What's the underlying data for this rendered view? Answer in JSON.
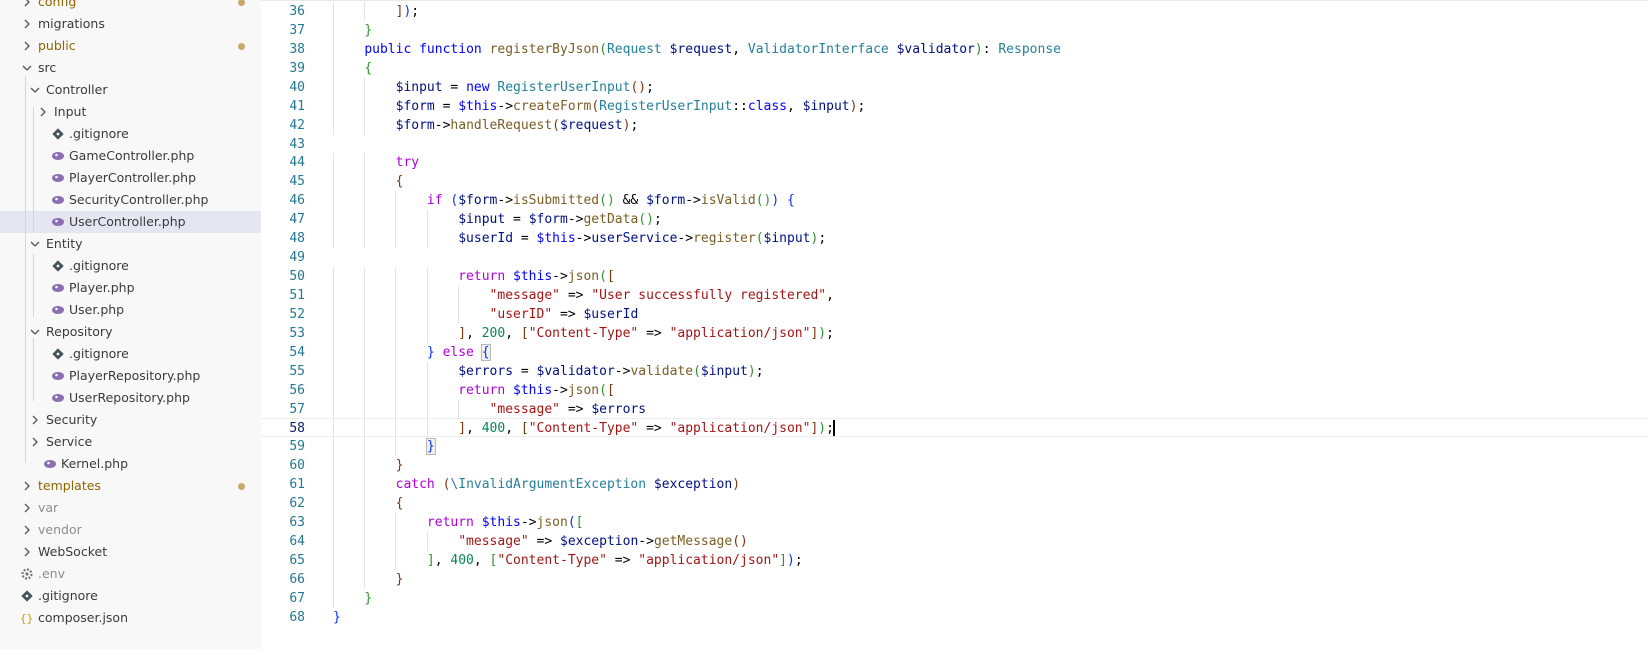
{
  "explorer": {
    "items": [
      {
        "label": "config",
        "kind": "folder",
        "state": "collapsed",
        "depth": 0,
        "status": "modified"
      },
      {
        "label": "migrations",
        "kind": "folder",
        "state": "collapsed",
        "depth": 0,
        "status": "normal"
      },
      {
        "label": "public",
        "kind": "folder",
        "state": "collapsed",
        "depth": 0,
        "status": "modified"
      },
      {
        "label": "src",
        "kind": "folder",
        "state": "expanded",
        "depth": 0,
        "status": "normal"
      },
      {
        "label": "Controller",
        "kind": "folder",
        "state": "expanded",
        "depth": 1,
        "status": "normal"
      },
      {
        "label": "Input",
        "kind": "folder",
        "state": "collapsed",
        "depth": 2,
        "status": "normal"
      },
      {
        "label": ".gitignore",
        "kind": "git",
        "depth": 2,
        "status": "normal"
      },
      {
        "label": "GameController.php",
        "kind": "php",
        "depth": 2,
        "status": "normal"
      },
      {
        "label": "PlayerController.php",
        "kind": "php",
        "depth": 2,
        "status": "normal"
      },
      {
        "label": "SecurityController.php",
        "kind": "php",
        "depth": 2,
        "status": "normal"
      },
      {
        "label": "UserController.php",
        "kind": "php",
        "depth": 2,
        "status": "normal",
        "selected": true
      },
      {
        "label": "Entity",
        "kind": "folder",
        "state": "expanded",
        "depth": 1,
        "status": "normal"
      },
      {
        "label": ".gitignore",
        "kind": "git",
        "depth": 2,
        "status": "normal"
      },
      {
        "label": "Player.php",
        "kind": "php",
        "depth": 2,
        "status": "normal"
      },
      {
        "label": "User.php",
        "kind": "php",
        "depth": 2,
        "status": "normal"
      },
      {
        "label": "Repository",
        "kind": "folder",
        "state": "expanded",
        "depth": 1,
        "status": "normal"
      },
      {
        "label": ".gitignore",
        "kind": "git",
        "depth": 2,
        "status": "normal"
      },
      {
        "label": "PlayerRepository.php",
        "kind": "php",
        "depth": 2,
        "status": "normal"
      },
      {
        "label": "UserRepository.php",
        "kind": "php",
        "depth": 2,
        "status": "normal"
      },
      {
        "label": "Security",
        "kind": "folder",
        "state": "collapsed",
        "depth": 1,
        "status": "normal"
      },
      {
        "label": "Service",
        "kind": "folder",
        "state": "collapsed",
        "depth": 1,
        "status": "normal"
      },
      {
        "label": "Kernel.php",
        "kind": "php",
        "depth": 1,
        "status": "normal"
      },
      {
        "label": "templates",
        "kind": "folder",
        "state": "collapsed",
        "depth": 0,
        "status": "modified"
      },
      {
        "label": "var",
        "kind": "folder",
        "state": "collapsed",
        "depth": 0,
        "status": "ignored"
      },
      {
        "label": "vendor",
        "kind": "folder",
        "state": "collapsed",
        "depth": 0,
        "status": "ignored"
      },
      {
        "label": "WebSocket",
        "kind": "folder",
        "state": "collapsed",
        "depth": 0,
        "status": "normal"
      },
      {
        "label": ".env",
        "kind": "env",
        "depth": 0,
        "status": "ignored"
      },
      {
        "label": ".gitignore",
        "kind": "git",
        "depth": 0,
        "status": "normal"
      },
      {
        "label": "composer.json",
        "kind": "json",
        "depth": 0,
        "status": "normal"
      }
    ]
  },
  "editor": {
    "current_line": 58,
    "lines": [
      {
        "n": "36",
        "indent": 2,
        "tokens": [
          [
            "]",
            "b3"
          ],
          [
            ")",
            "b1"
          ],
          [
            ";",
            ""
          ]
        ]
      },
      {
        "n": "37",
        "indent": 1,
        "tokens": [
          [
            "}",
            "b2"
          ]
        ]
      },
      {
        "n": "38",
        "indent": 1,
        "tokens": [
          [
            "public",
            "kw"
          ],
          [
            " ",
            ""
          ],
          [
            "function",
            "kw"
          ],
          [
            " ",
            ""
          ],
          [
            "registerByJson",
            "fn"
          ],
          [
            "(",
            "b2"
          ],
          [
            "Request",
            "cls"
          ],
          [
            " ",
            ""
          ],
          [
            "$request",
            "var"
          ],
          [
            ", ",
            ""
          ],
          [
            "ValidatorInterface",
            "cls"
          ],
          [
            " ",
            ""
          ],
          [
            "$validator",
            "var"
          ],
          [
            ")",
            "b2"
          ],
          [
            ": ",
            ""
          ],
          [
            "Response",
            "cls"
          ]
        ]
      },
      {
        "n": "39",
        "indent": 1,
        "tokens": [
          [
            "{",
            "b2"
          ]
        ]
      },
      {
        "n": "40",
        "indent": 2,
        "tokens": [
          [
            "$input",
            "var"
          ],
          [
            " = ",
            ""
          ],
          [
            "new",
            "kw"
          ],
          [
            " ",
            ""
          ],
          [
            "RegisterUserInput",
            "cls"
          ],
          [
            "()",
            "b3"
          ],
          [
            ";",
            ""
          ]
        ]
      },
      {
        "n": "41",
        "indent": 2,
        "tokens": [
          [
            "$form",
            "var"
          ],
          [
            " = ",
            ""
          ],
          [
            "$this",
            "kw"
          ],
          [
            "->",
            ""
          ],
          [
            "createForm",
            "fn"
          ],
          [
            "(",
            "b3"
          ],
          [
            "RegisterUserInput",
            "cls"
          ],
          [
            "::",
            ""
          ],
          [
            "class",
            "kw"
          ],
          [
            ", ",
            ""
          ],
          [
            "$input",
            "var"
          ],
          [
            ")",
            "b3"
          ],
          [
            ";",
            ""
          ]
        ]
      },
      {
        "n": "42",
        "indent": 2,
        "tokens": [
          [
            "$form",
            "var"
          ],
          [
            "->",
            ""
          ],
          [
            "handleRequest",
            "fn"
          ],
          [
            "(",
            "b3"
          ],
          [
            "$request",
            "var"
          ],
          [
            ")",
            "b3"
          ],
          [
            ";",
            ""
          ]
        ]
      },
      {
        "n": "43",
        "indent": 0,
        "tokens": []
      },
      {
        "n": "44",
        "indent": 2,
        "tokens": [
          [
            "try",
            "ctl"
          ]
        ]
      },
      {
        "n": "45",
        "indent": 2,
        "tokens": [
          [
            "{",
            "b3"
          ]
        ]
      },
      {
        "n": "46",
        "indent": 3,
        "tokens": [
          [
            "if",
            "ctl"
          ],
          [
            " ",
            ""
          ],
          [
            "(",
            "b1"
          ],
          [
            "$form",
            "var"
          ],
          [
            "->",
            ""
          ],
          [
            "isSubmitted",
            "fn"
          ],
          [
            "()",
            "b2"
          ],
          [
            " && ",
            ""
          ],
          [
            "$form",
            "var"
          ],
          [
            "->",
            ""
          ],
          [
            "isValid",
            "fn"
          ],
          [
            "()",
            "b2"
          ],
          [
            ")",
            "b1"
          ],
          [
            " ",
            ""
          ],
          [
            "{",
            "b1"
          ]
        ]
      },
      {
        "n": "47",
        "indent": 4,
        "tokens": [
          [
            "$input",
            "var"
          ],
          [
            " = ",
            ""
          ],
          [
            "$form",
            "var"
          ],
          [
            "->",
            ""
          ],
          [
            "getData",
            "fn"
          ],
          [
            "()",
            "b2"
          ],
          [
            ";",
            ""
          ]
        ]
      },
      {
        "n": "48",
        "indent": 4,
        "tokens": [
          [
            "$userId",
            "var"
          ],
          [
            " = ",
            ""
          ],
          [
            "$this",
            "kw"
          ],
          [
            "->",
            ""
          ],
          [
            "userService",
            "var"
          ],
          [
            "->",
            ""
          ],
          [
            "register",
            "fn"
          ],
          [
            "(",
            "b2"
          ],
          [
            "$input",
            "var"
          ],
          [
            ")",
            "b2"
          ],
          [
            ";",
            ""
          ]
        ]
      },
      {
        "n": "49",
        "indent": 0,
        "tokens": []
      },
      {
        "n": "50",
        "indent": 4,
        "tokens": [
          [
            "return",
            "ctl"
          ],
          [
            " ",
            ""
          ],
          [
            "$this",
            "kw"
          ],
          [
            "->",
            ""
          ],
          [
            "json",
            "fn"
          ],
          [
            "(",
            "b2"
          ],
          [
            "[",
            "b3"
          ]
        ]
      },
      {
        "n": "51",
        "indent": 5,
        "tokens": [
          [
            "\"message\"",
            "str"
          ],
          [
            " => ",
            ""
          ],
          [
            "\"User successfully registered\"",
            "str"
          ],
          [
            ",",
            ""
          ]
        ]
      },
      {
        "n": "52",
        "indent": 5,
        "tokens": [
          [
            "\"userID\"",
            "str"
          ],
          [
            " => ",
            ""
          ],
          [
            "$userId",
            "var"
          ]
        ]
      },
      {
        "n": "53",
        "indent": 4,
        "tokens": [
          [
            "]",
            "b3"
          ],
          [
            ", ",
            ""
          ],
          [
            "200",
            "num"
          ],
          [
            ", ",
            ""
          ],
          [
            "[",
            "b3"
          ],
          [
            "\"Content-Type\"",
            "str"
          ],
          [
            " => ",
            ""
          ],
          [
            "\"application/json\"",
            "str"
          ],
          [
            "]",
            "b3"
          ],
          [
            ")",
            "b2"
          ],
          [
            ";",
            ""
          ]
        ]
      },
      {
        "n": "54",
        "indent": 3,
        "tokens": [
          [
            "}",
            "b1"
          ],
          [
            " ",
            ""
          ],
          [
            "else",
            "ctl"
          ],
          [
            " ",
            ""
          ],
          [
            "{",
            "b1m"
          ]
        ]
      },
      {
        "n": "55",
        "indent": 4,
        "tokens": [
          [
            "$errors",
            "var"
          ],
          [
            " = ",
            ""
          ],
          [
            "$validator",
            "var"
          ],
          [
            "->",
            ""
          ],
          [
            "validate",
            "fn"
          ],
          [
            "(",
            "b2"
          ],
          [
            "$input",
            "var"
          ],
          [
            ")",
            "b2"
          ],
          [
            ";",
            ""
          ]
        ]
      },
      {
        "n": "56",
        "indent": 4,
        "tokens": [
          [
            "return",
            "ctl"
          ],
          [
            " ",
            ""
          ],
          [
            "$this",
            "kw"
          ],
          [
            "->",
            ""
          ],
          [
            "json",
            "fn"
          ],
          [
            "(",
            "b2"
          ],
          [
            "[",
            "b3"
          ]
        ]
      },
      {
        "n": "57",
        "indent": 5,
        "tokens": [
          [
            "\"message\"",
            "str"
          ],
          [
            " => ",
            ""
          ],
          [
            "$errors",
            "var"
          ]
        ]
      },
      {
        "n": "58",
        "indent": 4,
        "tokens": [
          [
            "]",
            "b3"
          ],
          [
            ", ",
            ""
          ],
          [
            "400",
            "num"
          ],
          [
            ", ",
            ""
          ],
          [
            "[",
            "b3"
          ],
          [
            "\"Content-Type\"",
            "str"
          ],
          [
            " => ",
            ""
          ],
          [
            "\"application/json\"",
            "str"
          ],
          [
            "]",
            "b3"
          ],
          [
            ")",
            "b2"
          ],
          [
            ";",
            ""
          ]
        ]
      },
      {
        "n": "59",
        "indent": 3,
        "tokens": [
          [
            "}",
            "b1m"
          ]
        ]
      },
      {
        "n": "60",
        "indent": 2,
        "tokens": [
          [
            "}",
            "b3"
          ]
        ]
      },
      {
        "n": "61",
        "indent": 2,
        "tokens": [
          [
            "catch",
            "ctl"
          ],
          [
            " ",
            ""
          ],
          [
            "(",
            "b3"
          ],
          [
            "\\InvalidArgumentException",
            "cls"
          ],
          [
            " ",
            ""
          ],
          [
            "$exception",
            "var"
          ],
          [
            ")",
            "b3"
          ]
        ]
      },
      {
        "n": "62",
        "indent": 2,
        "tokens": [
          [
            "{",
            "b3"
          ]
        ]
      },
      {
        "n": "63",
        "indent": 3,
        "tokens": [
          [
            "return",
            "ctl"
          ],
          [
            " ",
            ""
          ],
          [
            "$this",
            "kw"
          ],
          [
            "->",
            ""
          ],
          [
            "json",
            "fn"
          ],
          [
            "(",
            "b1"
          ],
          [
            "[",
            "b2"
          ]
        ]
      },
      {
        "n": "64",
        "indent": 4,
        "tokens": [
          [
            "\"message\"",
            "str"
          ],
          [
            " => ",
            ""
          ],
          [
            "$exception",
            "var"
          ],
          [
            "->",
            ""
          ],
          [
            "getMessage",
            "fn"
          ],
          [
            "()",
            "b3"
          ]
        ]
      },
      {
        "n": "65",
        "indent": 3,
        "tokens": [
          [
            "]",
            "b2"
          ],
          [
            ", ",
            ""
          ],
          [
            "400",
            "num"
          ],
          [
            ", ",
            ""
          ],
          [
            "[",
            "b2"
          ],
          [
            "\"Content-Type\"",
            "str"
          ],
          [
            " => ",
            ""
          ],
          [
            "\"application/json\"",
            "str"
          ],
          [
            "]",
            "b2"
          ],
          [
            ")",
            "b1"
          ],
          [
            ";",
            ""
          ]
        ]
      },
      {
        "n": "66",
        "indent": 2,
        "tokens": [
          [
            "}",
            "b3"
          ]
        ]
      },
      {
        "n": "67",
        "indent": 1,
        "tokens": [
          [
            "}",
            "b2"
          ]
        ]
      },
      {
        "n": "68",
        "indent": 0,
        "tokens": [
          [
            "}",
            "b1"
          ]
        ]
      }
    ]
  }
}
